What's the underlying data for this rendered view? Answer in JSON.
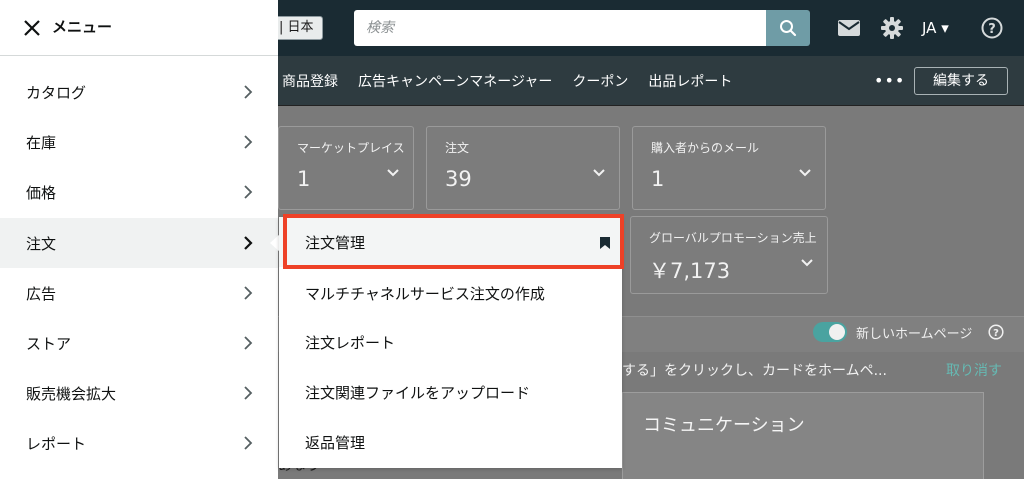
{
  "header": {
    "region_label": "| 日本",
    "search_placeholder": "検索",
    "language": "JA ▾"
  },
  "nav": {
    "links": [
      "商品登録",
      "広告キャンペーンマネージャー",
      "クーポン",
      "出品レポート"
    ],
    "more": "•••",
    "edit_label": "編集する"
  },
  "cards": [
    {
      "caption": "マーケットプレイス",
      "value": "1"
    },
    {
      "caption": "注文",
      "value": "39"
    },
    {
      "caption": "購入者からのメール",
      "value": "1"
    },
    {
      "caption": "グローバルプロモーション売上",
      "value": "￥7,173"
    }
  ],
  "home_toggle_label": "新しいホームページ",
  "message": {
    "text": "する」をクリックし、カードをホームペ...",
    "undo": "取り消す"
  },
  "communication_title": "コミュニケーション",
  "bottom_fragment": "あなう",
  "drawer": {
    "title": "メニュー",
    "items": [
      "カタログ",
      "在庫",
      "価格",
      "注文",
      "広告",
      "ストア",
      "販売機会拡大",
      "レポート"
    ]
  },
  "submenu": {
    "items": [
      "注文管理",
      "マルチチャネルサービス注文の作成",
      "注文レポート",
      "注文関連ファイルをアップロード",
      "返品管理"
    ]
  },
  "colors": {
    "highlight_border": "#ee4127",
    "toggle_on": "#4aa3a0",
    "link": "#66b9b3"
  }
}
